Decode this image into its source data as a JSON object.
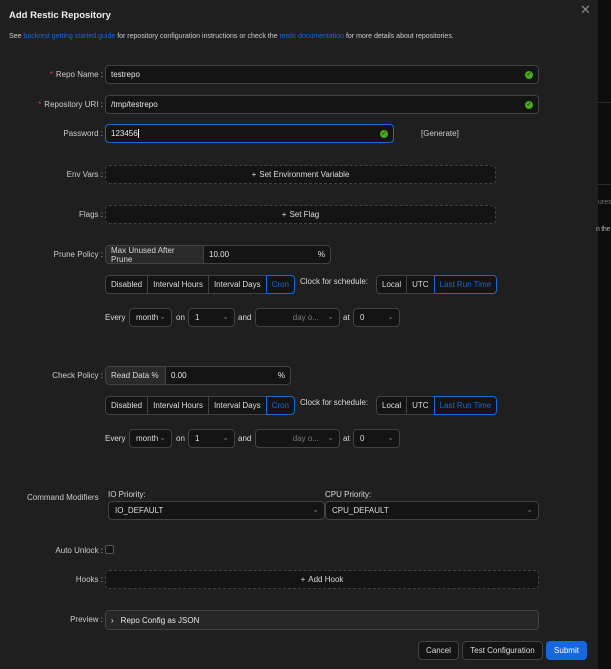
{
  "background": {
    "text1": "ures",
    "text2": "n the"
  },
  "dialog": {
    "title": "Add Restic Repository",
    "close_icon": "close-icon",
    "description": {
      "prefix": "See ",
      "link1": "backrest getting started guide",
      "middle": " for repository configuration instructions or check the ",
      "link2": "restic documentation",
      "suffix": " for more details about repositories."
    }
  },
  "form": {
    "repo_name": {
      "label": "Repo Name",
      "value": "testrepo"
    },
    "repo_uri": {
      "label": "Repository URI",
      "value": "/tmp/testrepo"
    },
    "password": {
      "label": "Password",
      "value": "123456",
      "generate": "[Generate]"
    },
    "env_vars": {
      "label": "Env Vars",
      "button": "Set Environment Variable"
    },
    "flags": {
      "label": "Flags",
      "button": "Set Flag"
    },
    "prune": {
      "label": "Prune Policy",
      "addon": "Max Unused After Prune",
      "value": "10.00",
      "suffix": "%",
      "modes": [
        "Disabled",
        "Interval Hours",
        "Interval Days",
        "Cron"
      ],
      "selected_mode": "Cron",
      "clock_label": "Clock for schedule:",
      "clocks": [
        "Local",
        "UTC",
        "Last Run Time"
      ],
      "selected_clock": "Last Run Time",
      "cron": {
        "every": "Every",
        "period": "month",
        "on": "on",
        "day": "1",
        "and": "and",
        "weekday_placeholder": "day o...",
        "at": "at",
        "hour": "0"
      }
    },
    "check": {
      "label": "Check Policy",
      "addon": "Read Data %",
      "value": "0.00",
      "suffix": "%",
      "modes": [
        "Disabled",
        "Interval Hours",
        "Interval Days",
        "Cron"
      ],
      "selected_mode": "Cron",
      "clock_label": "Clock for schedule:",
      "clocks": [
        "Local",
        "UTC",
        "Last Run Time"
      ],
      "selected_clock": "Last Run Time",
      "cron": {
        "every": "Every",
        "period": "month",
        "on": "on",
        "day": "1",
        "and": "and",
        "weekday_placeholder": "day o...",
        "at": "at",
        "hour": "0"
      }
    },
    "command_modifiers": {
      "label": "Command Modifiers",
      "io_label": "IO Priority:",
      "io_value": "IO_DEFAULT",
      "cpu_label": "CPU Priority:",
      "cpu_value": "CPU_DEFAULT"
    },
    "auto_unlock": {
      "label": "Auto Unlock",
      "checked": false
    },
    "hooks": {
      "label": "Hooks",
      "button": "Add Hook"
    },
    "preview": {
      "label": "Preview",
      "collapse": "Repo Config as JSON"
    }
  },
  "footer": {
    "cancel": "Cancel",
    "test": "Test Configuration",
    "submit": "Submit"
  },
  "colors": {
    "accent": "#1668dc",
    "success": "#49aa19",
    "required": "#dc4446"
  }
}
